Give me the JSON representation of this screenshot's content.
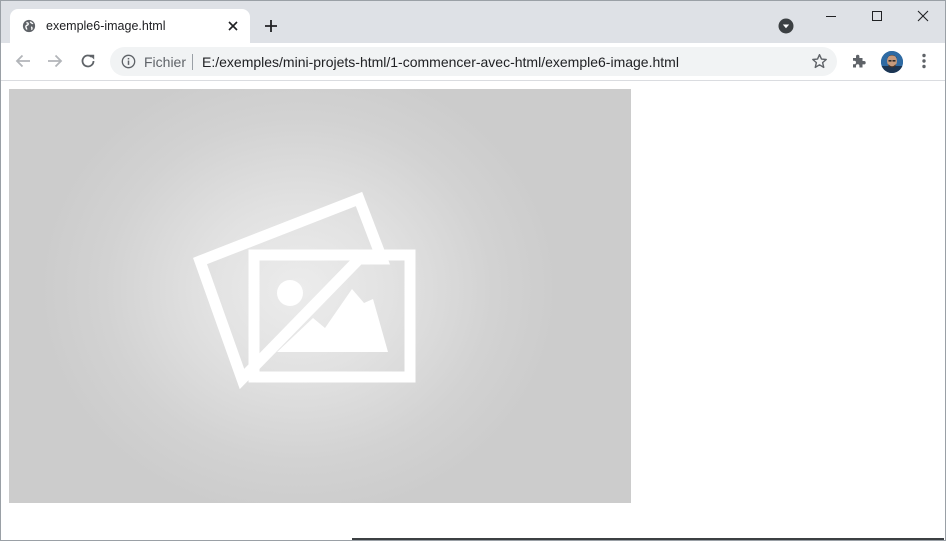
{
  "tab": {
    "title": "exemple6-image.html",
    "favicon": "globe-icon",
    "close_icon": "close-icon"
  },
  "tabstrip": {
    "new_tab_icon": "plus-icon",
    "tab_search_icon": "chevron-down-circle-icon"
  },
  "window_controls": [
    "minimize-icon",
    "maximize-icon",
    "close-icon"
  ],
  "toolbar": {
    "back_icon": "arrow-left-icon",
    "forward_icon": "arrow-right-icon",
    "reload_icon": "reload-icon",
    "extensions_icon": "puzzle-icon",
    "menu_icon": "kebab-menu-icon"
  },
  "omnibox": {
    "security_icon": "info-icon",
    "scheme_label": "Fichier",
    "url": "E:/exemples/mini-projets-html/1-commencer-avec-html/exemple6-image.html",
    "bookmark_icon": "star-icon"
  },
  "content": {
    "image": "placeholder-image-icon",
    "image_background": "#cccccc"
  },
  "colors": {
    "tabstrip_bg": "#dee1e6",
    "omnibox_bg": "#f1f3f4",
    "icon_gray": "#5f6368"
  }
}
